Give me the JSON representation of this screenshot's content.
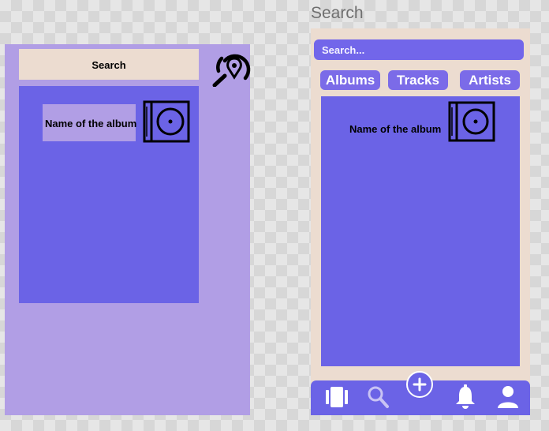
{
  "wireframe": {
    "search_label": "Search",
    "search_icon": "map-pin-search-icon",
    "album": {
      "name": "Name of the album",
      "icon": "vinyl-album-icon"
    }
  },
  "mockup": {
    "title": "Search",
    "search": {
      "placeholder": "Search...",
      "value": ""
    },
    "tabs": [
      {
        "label": "Albums"
      },
      {
        "label": "Tracks"
      },
      {
        "label": "Artists"
      }
    ],
    "album": {
      "name": "Name of the album",
      "icon": "vinyl-album-icon"
    },
    "bottom_nav": [
      {
        "name": "library",
        "icon": "library-icon"
      },
      {
        "name": "search",
        "icon": "search-icon"
      },
      {
        "name": "add",
        "icon": "plus-circle-icon"
      },
      {
        "name": "notifications",
        "icon": "bell-icon"
      },
      {
        "name": "profile",
        "icon": "user-icon"
      }
    ]
  },
  "colors": {
    "wireframe_frame": "#b19ee5",
    "panel": "#6b63e6",
    "search_bar_bg": "#ecdcd0",
    "input": "#7266ea",
    "tab": "#7b6be8"
  }
}
